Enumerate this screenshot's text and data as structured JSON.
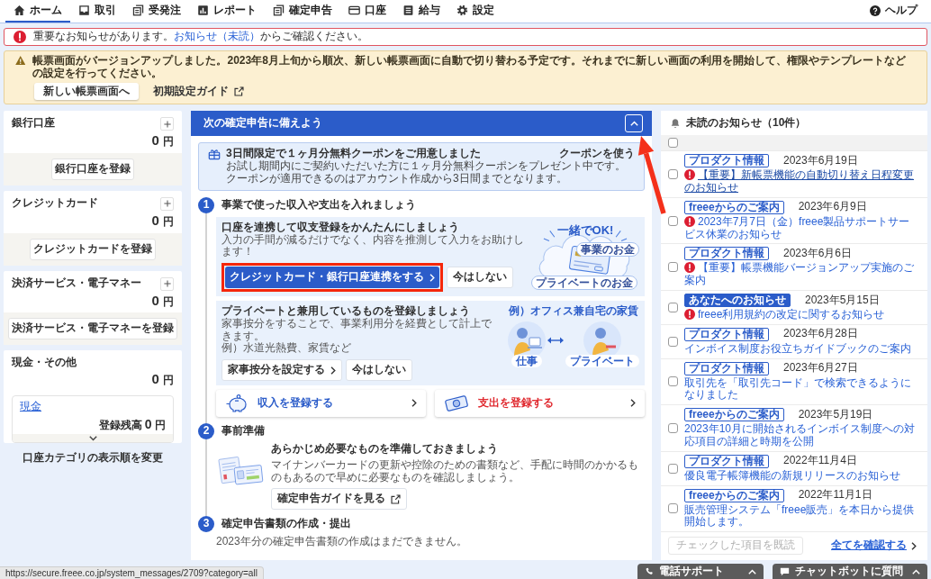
{
  "nav": {
    "tabs": [
      {
        "label": "ホーム",
        "selected": true
      },
      {
        "label": "取引",
        "selected": false
      },
      {
        "label": "受発注",
        "selected": false
      },
      {
        "label": "レポート",
        "selected": false
      },
      {
        "label": "確定申告",
        "selected": false
      },
      {
        "label": "口座",
        "selected": false
      },
      {
        "label": "給与",
        "selected": false
      },
      {
        "label": "設定",
        "selected": false
      }
    ],
    "help": "ヘルプ"
  },
  "important_notice": {
    "text": "重要なお知らせがあります。",
    "link": "お知らせ（未読）",
    "after": "からご確認ください。"
  },
  "update_notice": {
    "message": "帳票画面がバージョンアップしました。2023年8月上旬から順次、新しい帳票画面に自動で切り替わる予定です。それまでに新しい画面の利用を開始して、権限やテンプレートなどの設定を行ってください。",
    "buttons": [
      {
        "label": "新しい帳票画面へ",
        "kind": "button"
      },
      {
        "label": "初期設定ガイド",
        "kind": "external"
      }
    ]
  },
  "accounts": [
    {
      "kind": "register",
      "title": "銀行口座",
      "amount": "0",
      "unit": "円",
      "button": "銀行口座を登録"
    },
    {
      "kind": "register",
      "title": "クレジットカード",
      "amount": "0",
      "unit": "円",
      "button": "クレジットカードを登録"
    },
    {
      "kind": "register",
      "title": "決済サービス・電子マネー",
      "amount": "0",
      "unit": "円",
      "button": "決済サービス・電子マネーを登録"
    },
    {
      "kind": "cash",
      "title": "現金・その他",
      "amount": "0",
      "unit": "円",
      "wallet": {
        "link": "現金",
        "balance_label": "登録残高",
        "balance": "0",
        "unit": "円",
        "expanded": false
      }
    }
  ],
  "reorder_link": "口座カテゴリの表示順を変更",
  "tax_panel": {
    "title": "次の確定申告に備えよう",
    "expanded": true,
    "pointed": true,
    "coupon": {
      "title": "3日間限定で１ヶ月分無料クーポンをご用意しました",
      "lines": [
        "お試し期間内にご契約いただいた方に１ヶ月分無料クーポンをプレゼント中です。",
        "クーポンが適用できるのはアカウント作成から3日間までとなります。"
      ],
      "action": "クーポンを使う"
    },
    "steps": [
      {
        "number": "1",
        "kind": "entries",
        "title": "事業で使った収入や支出を入れましょう",
        "tasks": [
          {
            "title": "口座を連携して収支登録をかんたんにしましょう",
            "text": [
              "入力の手間が減るだけでなく、内容を推測して入力をお助けします！"
            ],
            "primary": {
              "label": "クレジットカード・銀行口座連携をする",
              "kind": "solid",
              "highlighted": true
            },
            "secondary": "今はしない",
            "art": {
              "kind": "card_cloud",
              "headline": "一緒でOK!",
              "labels": [
                "事業のお金",
                "プライベートのお金"
              ]
            }
          },
          {
            "title": "プライベートと兼用しているものを登録しましょう",
            "text": [
              "家事按分をすることで、事業利用分を経費として計上できます。",
              "例）水道光熱費、家賃など"
            ],
            "primary": {
              "label": "家事按分を設定する",
              "kind": "outline",
              "highlighted": false
            },
            "secondary": "今はしない",
            "art": {
              "kind": "home_office",
              "caption": "例）オフィス兼自宅の家賃",
              "labels": [
                "仕事",
                "プライベート"
              ]
            }
          }
        ],
        "shortcuts": [
          {
            "label": "収入を登録する",
            "kind": "income"
          },
          {
            "label": "支出を登録する",
            "kind": "expense"
          }
        ]
      },
      {
        "number": "2",
        "kind": "prepare",
        "title": "事前準備",
        "heading": "あらかじめ必要なものを準備しておきましょう",
        "text": "マイナンバーカードの更新や控除のための書類など、手配に時間のかかるものもあるので早めに必要なものを確認しましょう。",
        "button": "確定申告ガイドを見る"
      },
      {
        "number": "3",
        "kind": "documents",
        "title": "確定申告書類の作成・提出",
        "text": "2023年分の確定申告書類の作成はまだできません。"
      }
    ]
  },
  "notices": {
    "title": "未読のお知らせ（10件）",
    "select_all": {
      "checked": false
    },
    "items": [
      {
        "tag": {
          "label": "プロダクト情報",
          "kind": "outline"
        },
        "date": "2023年6月19日",
        "important": true,
        "hovered": true,
        "checked": false,
        "title": "【重要】新帳票機能の自動切り替え日程変更のお知らせ"
      },
      {
        "tag": {
          "label": "freeeからのご案内",
          "kind": "outline"
        },
        "date": "2023年6月9日",
        "important": true,
        "hovered": false,
        "checked": false,
        "title": "2023年7月7日（金）freee製品サポートサービス休業のお知らせ"
      },
      {
        "tag": {
          "label": "プロダクト情報",
          "kind": "outline"
        },
        "date": "2023年6月6日",
        "important": true,
        "hovered": false,
        "checked": false,
        "title": "【重要】帳票機能バージョンアップ実施のご案内"
      },
      {
        "tag": {
          "label": "あなたへのお知らせ",
          "kind": "solid"
        },
        "date": "2023年5月15日",
        "important": true,
        "hovered": false,
        "checked": false,
        "title": "freee利用規約の改定に関するお知らせ"
      },
      {
        "tag": {
          "label": "プロダクト情報",
          "kind": "outline"
        },
        "date": "2023年6月28日",
        "important": false,
        "hovered": false,
        "checked": false,
        "title": "インボイス制度お役立ちガイドブックのご案内"
      },
      {
        "tag": {
          "label": "プロダクト情報",
          "kind": "outline"
        },
        "date": "2023年6月27日",
        "important": false,
        "hovered": false,
        "checked": false,
        "title": "取引先を「取引先コード」で検索できるようになりました"
      },
      {
        "tag": {
          "label": "freeeからのご案内",
          "kind": "outline"
        },
        "date": "2023年5月19日",
        "important": false,
        "hovered": false,
        "checked": false,
        "title": "2023年10月に開始されるインボイス制度への対応項目の詳細と時期を公開"
      },
      {
        "tag": {
          "label": "プロダクト情報",
          "kind": "outline"
        },
        "date": "2022年11月4日",
        "important": false,
        "hovered": false,
        "checked": false,
        "title": "優良電子帳簿機能の新規リリースのお知らせ"
      },
      {
        "tag": {
          "label": "freeeからのご案内",
          "kind": "outline"
        },
        "date": "2022年11月1日",
        "important": false,
        "hovered": false,
        "checked": false,
        "title": "販売管理システム「freee販売」を本日から提供開始します。"
      }
    ],
    "mark_read": {
      "label": "チェックした項目を既読",
      "disabled": true
    },
    "view_all": "全てを確認する"
  },
  "support": [
    {
      "kind": "phone",
      "label": "電話サポート"
    },
    {
      "kind": "chat",
      "label": "チャットボットに質問"
    }
  ],
  "status_url": "https://secure.freee.co.jp/system_messages/2709?category=all"
}
